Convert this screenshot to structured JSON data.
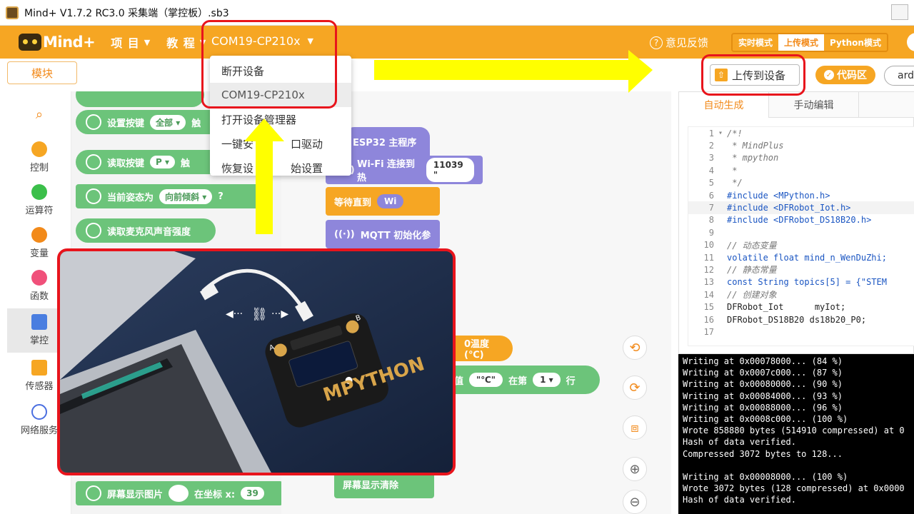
{
  "window": {
    "title": "Mind+ V1.7.2 RC3.0   采集端（掌控板）.sb3"
  },
  "menubar": {
    "logo_text": "Mind+",
    "items": [
      {
        "label": "项 目"
      },
      {
        "label": "教 程"
      }
    ],
    "com_port": "COM19-CP210x",
    "feedback": "意见反馈",
    "modes": [
      "实时模式",
      "上传模式",
      "Python模式"
    ],
    "active_mode": "上传模式"
  },
  "toolbar": {
    "module_label": "模块",
    "upload_label": "上传到设备",
    "code_toggle_label": "代码区",
    "board_select_value": "ard"
  },
  "dropdown": {
    "items": [
      "断开设备",
      "COM19-CP210x",
      "打开设备管理器",
      "一键安装串口驱动",
      "恢复设备初始设置"
    ],
    "visible_items": [
      "断开设备",
      "COM19-CP210x",
      "打开设备管理器",
      "一键安",
      "口驱动",
      "恢复设",
      "始设置"
    ]
  },
  "sidebar": {
    "items": [
      {
        "label": "控制",
        "color": "#f6a623"
      },
      {
        "label": "运算符",
        "color": "#3bbf4a"
      },
      {
        "label": "变量",
        "color": "#f28a1a"
      },
      {
        "label": "函数",
        "color": "#f0507a"
      },
      {
        "label": "掌控",
        "color": "#4a7ee0"
      },
      {
        "label": "传感器",
        "color": "#f6a623"
      },
      {
        "label": "网络服务",
        "color": "#4a6ee0"
      }
    ]
  },
  "palette": {
    "blocks": [
      {
        "text": "设置按键",
        "chip": "全部 ▾",
        "tail": "触"
      },
      {
        "text": "读取按键",
        "chip": "P ▾",
        "tail": "触"
      },
      {
        "text": "当前姿态为",
        "chip": "向前倾斜 ▾",
        "tail": "?"
      },
      {
        "text": "读取麦克风声音强度"
      },
      {
        "text": "屏幕显示图片",
        "tail": "在坐标 x:",
        "num": "39"
      }
    ]
  },
  "workspace": {
    "blocks": {
      "main": "ESP32 主程序",
      "wifi": "Wi-Fi 连接到 热",
      "wifi_pill": "11039 \"",
      "wait": "等待直到",
      "wait_tail": "Wi",
      "mqtt": "MQTT 初始化参",
      "temp": "0温度(℃)",
      "value": "值",
      "unit": "\"℃\"",
      "row_text": "在第",
      "row_num": "1 ▾",
      "row_tail": "行",
      "clear": "屏幕显示清除"
    },
    "icon_labels": {
      "wifi": "WIFI",
      "mqtt": "MQTT"
    }
  },
  "code_panel": {
    "tabs": [
      "自动生成",
      "手动编辑"
    ],
    "lines": [
      {
        "n": "1",
        "t": "/*!",
        "c": "cmt",
        "fold": "▾"
      },
      {
        "n": "2",
        "t": " * MindPlus",
        "c": "cmt"
      },
      {
        "n": "3",
        "t": " * mpython",
        "c": "cmt"
      },
      {
        "n": "4",
        "t": " *",
        "c": "cmt"
      },
      {
        "n": "5",
        "t": " */",
        "c": "cmt"
      },
      {
        "n": "6",
        "t": "#include <MPython.h>",
        "c": "kw"
      },
      {
        "n": "7",
        "t": "#include <DFRobot_Iot.h>",
        "c": "kw",
        "hl": true
      },
      {
        "n": "8",
        "t": "#include <DFRobot_DS18B20.h>",
        "c": "kw"
      },
      {
        "n": "9",
        "t": "",
        "c": "plain"
      },
      {
        "n": "10",
        "t": "// 动态变量",
        "c": "cmt"
      },
      {
        "n": "11",
        "t": "volatile float mind_n_WenDuZhi;",
        "c": "kw"
      },
      {
        "n": "12",
        "t": "// 静态常量",
        "c": "cmt"
      },
      {
        "n": "13",
        "t": "const String topics[5] = {\"STEM",
        "c": "kw"
      },
      {
        "n": "14",
        "t": "// 创建对象",
        "c": "cmt"
      },
      {
        "n": "15",
        "t": "DFRobot_Iot      myIot;",
        "c": "plain"
      },
      {
        "n": "16",
        "t": "DFRobot_DS18B20 ds18b20_P0;",
        "c": "plain"
      },
      {
        "n": "17",
        "t": "",
        "c": "plain"
      }
    ]
  },
  "console": {
    "lines": [
      "Writing at 0x00078000... (84 %)",
      "Writing at 0x0007c000... (87 %)",
      "Writing at 0x00080000... (90 %)",
      "Writing at 0x00084000... (93 %)",
      "Writing at 0x00088000... (96 %)",
      "Writing at 0x0008c000... (100 %)",
      "Wrote 858880 bytes (514910 compressed) at 0",
      "Hash of data verified.",
      "Compressed 3072 bytes to 128...",
      "",
      "Writing at 0x00008000... (100 %)",
      "Wrote 3072 bytes (128 compressed) at 0x0000",
      "Hash of data verified."
    ]
  },
  "photo": {
    "board_brand": "MPYTHON",
    "pin_a": "A",
    "pin_b": "B"
  },
  "colors": {
    "brand_orange": "#f6a623",
    "annotation_red": "#e8141c",
    "annotation_yellow": "#ffff00"
  }
}
